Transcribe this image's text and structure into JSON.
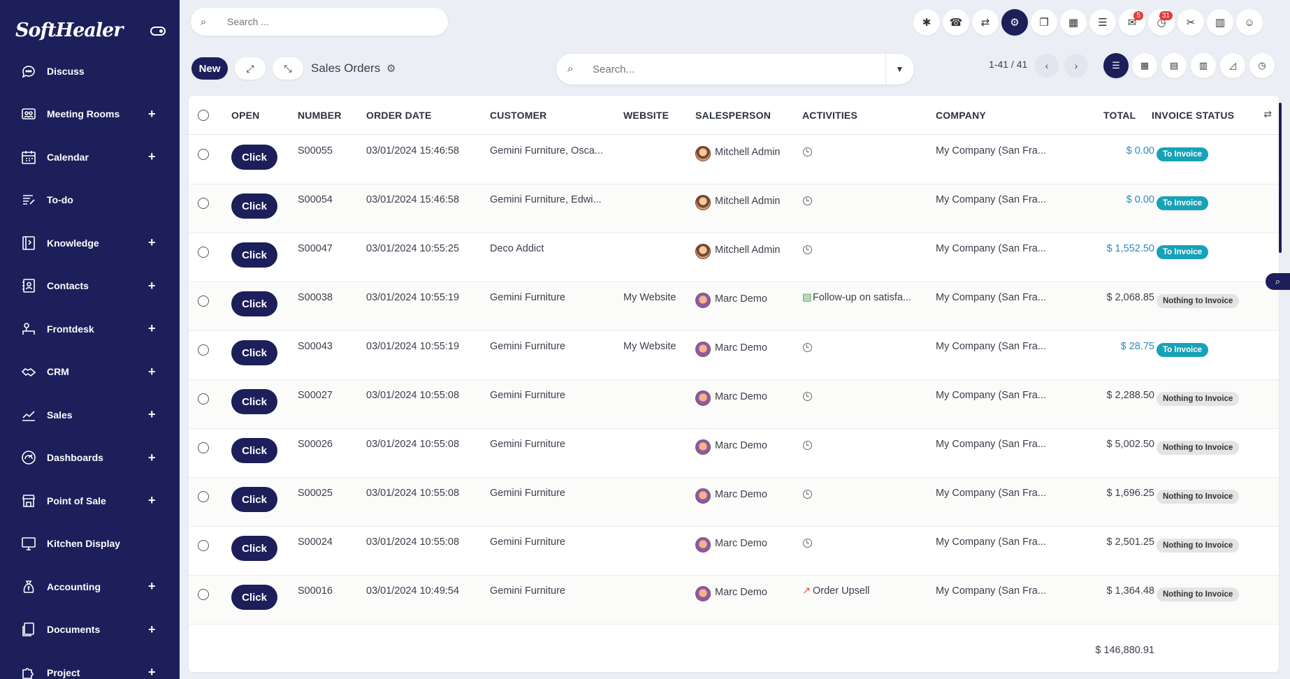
{
  "brand": "SoftHealer",
  "sidebar": {
    "items": [
      {
        "label": "Discuss",
        "icon": "chat-icon",
        "plus": ""
      },
      {
        "label": "Meeting Rooms",
        "icon": "meeting-rooms-icon",
        "plus": "+"
      },
      {
        "label": "Calendar",
        "icon": "calendar-icon",
        "plus": "+"
      },
      {
        "label": "To-do",
        "icon": "todo-icon",
        "plus": ""
      },
      {
        "label": "Knowledge",
        "icon": "knowledge-icon",
        "plus": "+"
      },
      {
        "label": "Contacts",
        "icon": "contacts-icon",
        "plus": "+"
      },
      {
        "label": "Frontdesk",
        "icon": "frontdesk-icon",
        "plus": "+"
      },
      {
        "label": "CRM",
        "icon": "handshake-icon",
        "plus": "+"
      },
      {
        "label": "Sales",
        "icon": "chart-line-icon",
        "plus": "+"
      },
      {
        "label": "Dashboards",
        "icon": "dashboard-icon",
        "plus": "+"
      },
      {
        "label": "Point of Sale",
        "icon": "store-icon",
        "plus": "+"
      },
      {
        "label": "Kitchen Display",
        "icon": "monitor-icon",
        "plus": ""
      },
      {
        "label": "Accounting",
        "icon": "money-bag-icon",
        "plus": "+"
      },
      {
        "label": "Documents",
        "icon": "documents-icon",
        "plus": "+"
      },
      {
        "label": "Project",
        "icon": "puzzle-icon",
        "plus": "+"
      }
    ]
  },
  "topbar": {
    "search_placeholder": "Search ...",
    "icons": [
      {
        "name": "bug-icon",
        "glyph": "✱",
        "badge": ""
      },
      {
        "name": "phone-icon",
        "glyph": "☎",
        "badge": ""
      },
      {
        "name": "translate-icon",
        "glyph": "⇄",
        "badge": ""
      },
      {
        "name": "settings-icon",
        "glyph": "⚙",
        "badge": "",
        "active": true
      },
      {
        "name": "bookmark-icon",
        "glyph": "❐",
        "badge": ""
      },
      {
        "name": "calculator-icon",
        "glyph": "▦",
        "badge": ""
      },
      {
        "name": "server-icon",
        "glyph": "☰",
        "badge": ""
      },
      {
        "name": "messages-icon",
        "glyph": "✉",
        "badge": "5"
      },
      {
        "name": "activity-clock-icon",
        "glyph": "◷",
        "badge": "31"
      },
      {
        "name": "tools-icon",
        "glyph": "✂",
        "badge": ""
      },
      {
        "name": "building-icon",
        "glyph": "▥",
        "badge": ""
      },
      {
        "name": "user-avatar-icon",
        "glyph": "☺",
        "badge": ""
      }
    ]
  },
  "control": {
    "new_label": "New",
    "breadcrumb": "Sales Orders",
    "search_placeholder": "Search...",
    "pager": "1-41 / 41"
  },
  "table": {
    "headers": {
      "open": "OPEN",
      "number": "NUMBER",
      "order_date": "ORDER DATE",
      "customer": "CUSTOMER",
      "website": "WEBSITE",
      "salesperson": "SALESPERSON",
      "activities": "ACTIVITIES",
      "company": "COMPANY",
      "total": "TOTAL",
      "invoice_status": "INVOICE STATUS"
    },
    "click_label": "Click",
    "rows": [
      {
        "number": "S00055",
        "date": "03/01/2024 15:46:58",
        "customer": "Gemini Furniture, Osca...",
        "website": "",
        "salesperson": "Mitchell Admin",
        "avatar": "admin",
        "activity": "",
        "activity_type": "clock",
        "company": "My Company (San Fra...",
        "total": "$ 0.00",
        "total_blue": true,
        "status": "To Invoice",
        "status_type": "to"
      },
      {
        "number": "S00054",
        "date": "03/01/2024 15:46:58",
        "customer": "Gemini Furniture, Edwi...",
        "website": "",
        "salesperson": "Mitchell Admin",
        "avatar": "admin",
        "activity": "",
        "activity_type": "clock",
        "company": "My Company (San Fra...",
        "total": "$ 0.00",
        "total_blue": true,
        "status": "To Invoice",
        "status_type": "to"
      },
      {
        "number": "S00047",
        "date": "03/01/2024 10:55:25",
        "customer": "Deco Addict",
        "website": "",
        "salesperson": "Mitchell Admin",
        "avatar": "admin",
        "activity": "",
        "activity_type": "clock",
        "company": "My Company (San Fra...",
        "total": "$ 1,552.50",
        "total_blue": true,
        "status": "To Invoice",
        "status_type": "to"
      },
      {
        "number": "S00038",
        "date": "03/01/2024 10:55:19",
        "customer": "Gemini Furniture",
        "website": "My Website",
        "salesperson": "Marc Demo",
        "avatar": "demo",
        "activity": "Follow-up on satisfa...",
        "activity_type": "money",
        "company": "My Company (San Fra...",
        "total": "$ 2,068.85",
        "total_blue": false,
        "status": "Nothing to Invoice",
        "status_type": "nothing"
      },
      {
        "number": "S00043",
        "date": "03/01/2024 10:55:19",
        "customer": "Gemini Furniture",
        "website": "My Website",
        "salesperson": "Marc Demo",
        "avatar": "demo",
        "activity": "",
        "activity_type": "clock",
        "company": "My Company (San Fra...",
        "total": "$ 28.75",
        "total_blue": true,
        "status": "To Invoice",
        "status_type": "to"
      },
      {
        "number": "S00027",
        "date": "03/01/2024 10:55:08",
        "customer": "Gemini Furniture",
        "website": "",
        "salesperson": "Marc Demo",
        "avatar": "demo",
        "activity": "",
        "activity_type": "clock",
        "company": "My Company (San Fra...",
        "total": "$ 2,288.50",
        "total_blue": false,
        "status": "Nothing to Invoice",
        "status_type": "nothing"
      },
      {
        "number": "S00026",
        "date": "03/01/2024 10:55:08",
        "customer": "Gemini Furniture",
        "website": "",
        "salesperson": "Marc Demo",
        "avatar": "demo",
        "activity": "",
        "activity_type": "clock",
        "company": "My Company (San Fra...",
        "total": "$ 5,002.50",
        "total_blue": false,
        "status": "Nothing to Invoice",
        "status_type": "nothing"
      },
      {
        "number": "S00025",
        "date": "03/01/2024 10:55:08",
        "customer": "Gemini Furniture",
        "website": "",
        "salesperson": "Marc Demo",
        "avatar": "demo",
        "activity": "",
        "activity_type": "clock",
        "company": "My Company (San Fra...",
        "total": "$ 1,696.25",
        "total_blue": false,
        "status": "Nothing to Invoice",
        "status_type": "nothing"
      },
      {
        "number": "S00024",
        "date": "03/01/2024 10:55:08",
        "customer": "Gemini Furniture",
        "website": "",
        "salesperson": "Marc Demo",
        "avatar": "demo",
        "activity": "",
        "activity_type": "clock",
        "company": "My Company (San Fra...",
        "total": "$ 2,501.25",
        "total_blue": false,
        "status": "Nothing to Invoice",
        "status_type": "nothing"
      },
      {
        "number": "S00016",
        "date": "03/01/2024 10:49:54",
        "customer": "Gemini Furniture",
        "website": "",
        "salesperson": "Marc Demo",
        "avatar": "demo",
        "activity": "Order Upsell",
        "activity_type": "chart",
        "company": "My Company (San Fra...",
        "total": "$ 1,364.48",
        "total_blue": false,
        "status": "Nothing to Invoice",
        "status_type": "nothing"
      }
    ],
    "grand_total": "$ 146,880.91"
  },
  "colors": {
    "sidebar_bg": "#1c1f5a",
    "to_invoice": "#17a2b8",
    "total_blue": "#2a8bc0"
  }
}
